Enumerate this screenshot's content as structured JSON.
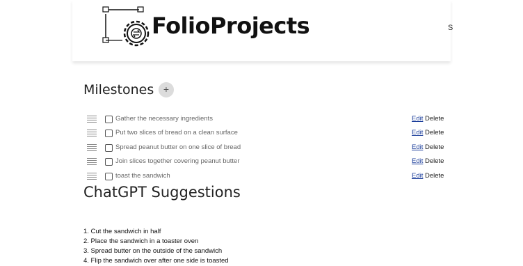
{
  "header": {
    "brand": "FolioProjects",
    "cut_off_text": "S"
  },
  "milestones": {
    "title": "Milestones",
    "add_label": "+",
    "edit_label": "Edit",
    "delete_label": "Delete",
    "items": [
      {
        "text": "Gather the necessary ingredients",
        "checked": false
      },
      {
        "text": "Put two slices of bread on a clean surface",
        "checked": false
      },
      {
        "text": "Spread peanut butter on one slice of bread",
        "checked": false
      },
      {
        "text": "Join slices together covering peanut butter",
        "checked": false
      },
      {
        "text": "toast the sandwich",
        "checked": false
      }
    ]
  },
  "suggestions": {
    "title": "ChatGPT Suggestions",
    "items": [
      "1. Cut the sandwich in half",
      "2. Place the sandwich in a toaster oven",
      "3. Spread butter on the outside of the sandwich",
      "4. Flip the sandwich over after one side is toasted"
    ]
  },
  "icons": {
    "logo": "gear-logo-icon",
    "drag": "drag-handle-icon"
  },
  "colors": {
    "link": "#1a3c9a",
    "add_button_bg": "#dcdcdc",
    "item_text": "#666666"
  }
}
